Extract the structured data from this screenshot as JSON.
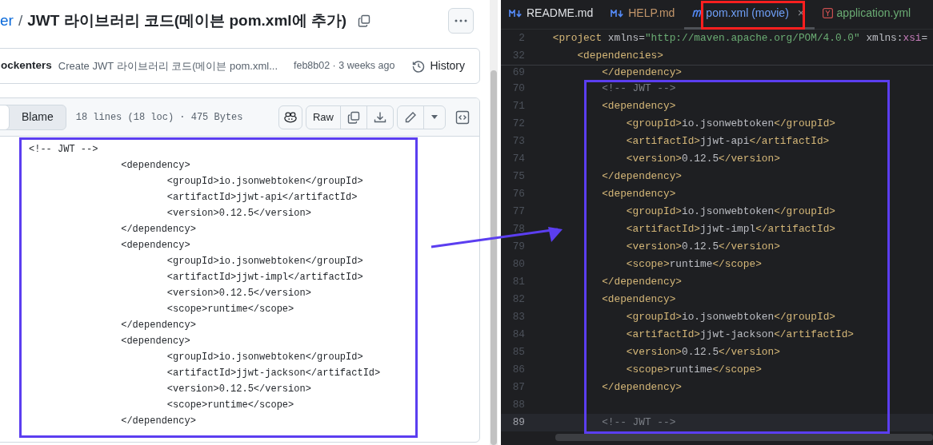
{
  "breadcrumb": {
    "link": "er",
    "separator": "/",
    "title": "JWT 라이브러리 코드(메이븐 pom.xml에 추가)"
  },
  "commit": {
    "author": "ockenters",
    "message": "Create JWT 라이브러리 코드(메이븐 pom.xml...",
    "meta": "feb8b02 · 3 weeks ago",
    "history_button": "History"
  },
  "file_header": {
    "view_tabs": [
      {
        "label": "Blame",
        "selected": false
      }
    ],
    "info": "18 lines (18 loc) · 475 Bytes",
    "raw_button": "Raw"
  },
  "code_lines": [
    "<!-- JWT -->",
    "\t\t<dependency>",
    "\t\t\t<groupId>io.jsonwebtoken</groupId>",
    "\t\t\t<artifactId>jjwt-api</artifactId>",
    "\t\t\t<version>0.12.5</version>",
    "\t\t</dependency>",
    "\t\t<dependency>",
    "\t\t\t<groupId>io.jsonwebtoken</groupId>",
    "\t\t\t<artifactId>jjwt-impl</artifactId>",
    "\t\t\t<version>0.12.5</version>",
    "\t\t\t<scope>runtime</scope>",
    "\t\t</dependency>",
    "\t\t<dependency>",
    "\t\t\t<groupId>io.jsonwebtoken</groupId>",
    "\t\t\t<artifactId>jjwt-jackson</artifactId>",
    "\t\t\t<version>0.12.5</version>",
    "\t\t\t<scope>runtime</scope>",
    "\t\t</dependency>"
  ],
  "editor": {
    "tabs": [
      {
        "label": "README.md",
        "kind": "markdown",
        "color": "#dfe1e5",
        "selected": false
      },
      {
        "label": "HELP.md",
        "kind": "markdown",
        "color": "#c3966a",
        "selected": false
      },
      {
        "label": "pom.xml (movie)",
        "kind": "maven",
        "color": "#6f9ff7",
        "selected": true,
        "close": "×"
      },
      {
        "label": "application.yml",
        "kind": "yaml",
        "color": "#6aab73",
        "selected": false
      }
    ],
    "sticky_lines": [
      {
        "number": "2",
        "segments": [
          {
            "kind": "tag",
            "text": "    <project"
          },
          {
            "kind": "attr",
            "text": " xmlns"
          },
          {
            "kind": "text",
            "text": "="
          },
          {
            "kind": "string",
            "text": "\"http://maven.apache.org/POM/4.0.0\""
          },
          {
            "kind": "attr",
            "text": " xmlns"
          },
          {
            "kind": "text",
            "text": ":"
          },
          {
            "kind": "ns",
            "text": "xsi"
          },
          {
            "kind": "text",
            "text": "="
          }
        ]
      },
      {
        "number": "32",
        "segments": [
          {
            "kind": "tag",
            "text": "        <dependencies>"
          }
        ]
      }
    ],
    "lines": [
      {
        "number": "69",
        "current": false,
        "segments": [
          {
            "kind": "tag",
            "text": "            </dependency>"
          }
        ]
      },
      {
        "number": "70",
        "current": false,
        "segments": [
          {
            "kind": "comment",
            "text": "            <!-- JWT -->"
          }
        ]
      },
      {
        "number": "71",
        "current": false,
        "segments": [
          {
            "kind": "tag",
            "text": "            <dependency>"
          }
        ]
      },
      {
        "number": "72",
        "current": false,
        "segments": [
          {
            "kind": "tag",
            "text": "                <groupId>"
          },
          {
            "kind": "text",
            "text": "io.jsonwebtoken"
          },
          {
            "kind": "tag",
            "text": "</groupId>"
          }
        ]
      },
      {
        "number": "73",
        "current": false,
        "segments": [
          {
            "kind": "tag",
            "text": "                <artifactId>"
          },
          {
            "kind": "text",
            "text": "jjwt-api"
          },
          {
            "kind": "tag",
            "text": "</artifactId>"
          }
        ]
      },
      {
        "number": "74",
        "current": false,
        "segments": [
          {
            "kind": "tag",
            "text": "                <version>"
          },
          {
            "kind": "text",
            "text": "0.12.5"
          },
          {
            "kind": "tag",
            "text": "</version>"
          }
        ]
      },
      {
        "number": "75",
        "current": false,
        "segments": [
          {
            "kind": "tag",
            "text": "            </dependency>"
          }
        ]
      },
      {
        "number": "76",
        "current": false,
        "segments": [
          {
            "kind": "tag",
            "text": "            <dependency>"
          }
        ]
      },
      {
        "number": "77",
        "current": false,
        "segments": [
          {
            "kind": "tag",
            "text": "                <groupId>"
          },
          {
            "kind": "text",
            "text": "io.jsonwebtoken"
          },
          {
            "kind": "tag",
            "text": "</groupId>"
          }
        ]
      },
      {
        "number": "78",
        "current": false,
        "segments": [
          {
            "kind": "tag",
            "text": "                <artifactId>"
          },
          {
            "kind": "text",
            "text": "jjwt-impl"
          },
          {
            "kind": "tag",
            "text": "</artifactId>"
          }
        ]
      },
      {
        "number": "79",
        "current": false,
        "segments": [
          {
            "kind": "tag",
            "text": "                <version>"
          },
          {
            "kind": "text",
            "text": "0.12.5"
          },
          {
            "kind": "tag",
            "text": "</version>"
          }
        ]
      },
      {
        "number": "80",
        "current": false,
        "segments": [
          {
            "kind": "tag",
            "text": "                <scope>"
          },
          {
            "kind": "text",
            "text": "runtime"
          },
          {
            "kind": "tag",
            "text": "</scope>"
          }
        ]
      },
      {
        "number": "81",
        "current": false,
        "segments": [
          {
            "kind": "tag",
            "text": "            </dependency>"
          }
        ]
      },
      {
        "number": "82",
        "current": false,
        "segments": [
          {
            "kind": "tag",
            "text": "            <dependency>"
          }
        ]
      },
      {
        "number": "83",
        "current": false,
        "segments": [
          {
            "kind": "tag",
            "text": "                <groupId>"
          },
          {
            "kind": "text",
            "text": "io.jsonwebtoken"
          },
          {
            "kind": "tag",
            "text": "</groupId>"
          }
        ]
      },
      {
        "number": "84",
        "current": false,
        "segments": [
          {
            "kind": "tag",
            "text": "                <artifactId>"
          },
          {
            "kind": "text",
            "text": "jjwt-jackson"
          },
          {
            "kind": "tag",
            "text": "</artifactId>"
          }
        ]
      },
      {
        "number": "85",
        "current": false,
        "segments": [
          {
            "kind": "tag",
            "text": "                <version>"
          },
          {
            "kind": "text",
            "text": "0.12.5"
          },
          {
            "kind": "tag",
            "text": "</version>"
          }
        ]
      },
      {
        "number": "86",
        "current": false,
        "segments": [
          {
            "kind": "tag",
            "text": "                <scope>"
          },
          {
            "kind": "text",
            "text": "runtime"
          },
          {
            "kind": "tag",
            "text": "</scope>"
          }
        ]
      },
      {
        "number": "87",
        "current": false,
        "segments": [
          {
            "kind": "tag",
            "text": "            </dependency>"
          }
        ]
      },
      {
        "number": "88",
        "current": false
      },
      {
        "number": "89",
        "current": true,
        "segments": [
          {
            "kind": "comment",
            "text": "            <!-- JWT -->"
          }
        ]
      }
    ]
  },
  "annotations": [
    {
      "kind": "box",
      "color": "#5b3ef0"
    },
    {
      "kind": "box",
      "color": "#5b3ef0"
    },
    {
      "kind": "box",
      "color": "#ff1f1f"
    },
    {
      "kind": "arrow",
      "color": "#5b3ef0"
    }
  ]
}
